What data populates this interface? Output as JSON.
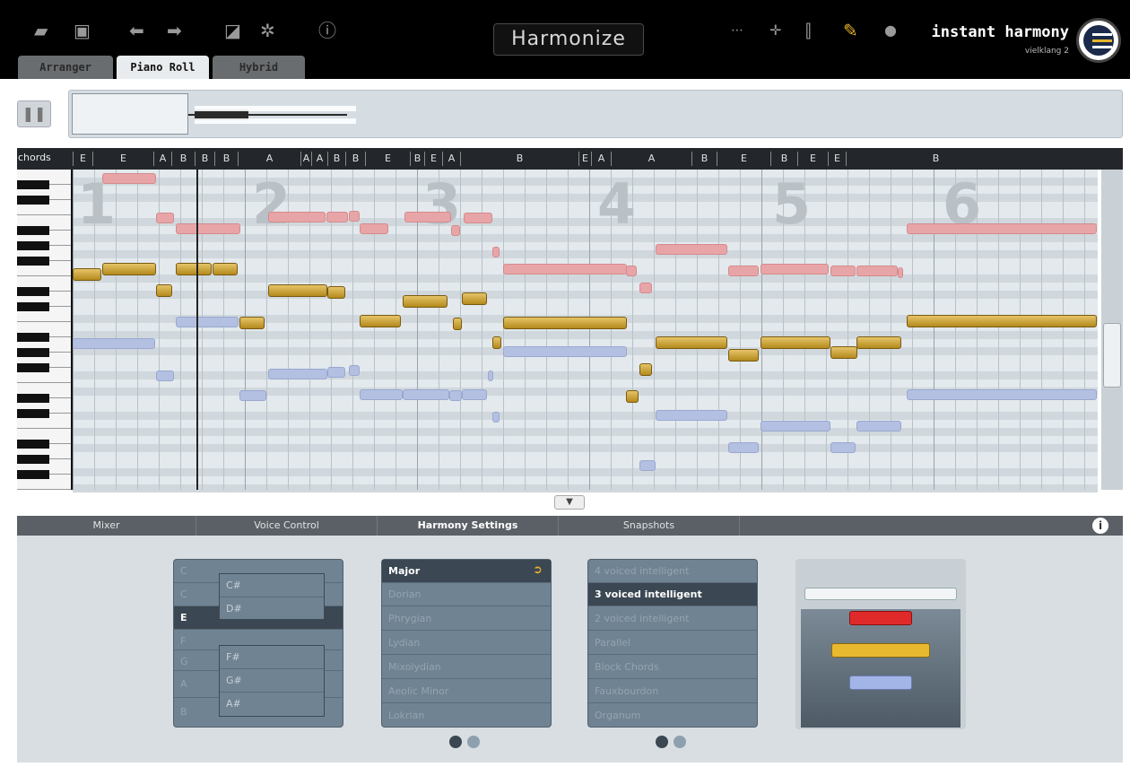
{
  "header": {
    "harmonize_label": "Harmonize",
    "brand_name": "instant harmony",
    "brand_sub": "vielklang 2",
    "icons": [
      "folder-open-icon",
      "save-icon",
      "undo-icon",
      "redo-icon",
      "edit-icon",
      "gear-icon",
      "help-icon",
      "stretch-icon",
      "move-icon",
      "split-icon",
      "link-icon",
      "record-icon"
    ],
    "tabs": [
      {
        "label": "Arranger"
      },
      {
        "label": "Piano Roll"
      },
      {
        "label": "Hybrid"
      }
    ]
  },
  "piano_roll": {
    "chords_label": "chords",
    "chords": [
      "E",
      "E",
      "A",
      "B",
      "B",
      "B",
      "A",
      "A",
      "A",
      "B",
      "B",
      "E",
      "B",
      "E",
      "A",
      "B",
      "E",
      "A",
      "A",
      "B",
      "E",
      "B",
      "E",
      "E",
      "B"
    ],
    "bar_numbers": [
      "1",
      "2",
      "3",
      "4",
      "5",
      "6"
    ]
  },
  "panel": {
    "tabs": [
      "Mixer",
      "Voice Control",
      "Harmony Settings",
      "Snapshots"
    ],
    "keys": [
      "C",
      "C",
      "E",
      "F",
      "G",
      "A",
      "B"
    ],
    "sharps_top": [
      "C#",
      "D#"
    ],
    "sharps_bottom": [
      "F#",
      "G#",
      "A#"
    ],
    "scales": [
      "Major",
      "Dorian",
      "Phrygian",
      "Lydian",
      "Mixolydian",
      "Aeolic Minor",
      "Lokrian"
    ],
    "voicings": [
      "4 voiced intelligent",
      "3 voiced intelligent",
      "2 voiced intelligent",
      "Parallel",
      "Block Chords",
      "Fauxbourdon",
      "Organum"
    ]
  }
}
